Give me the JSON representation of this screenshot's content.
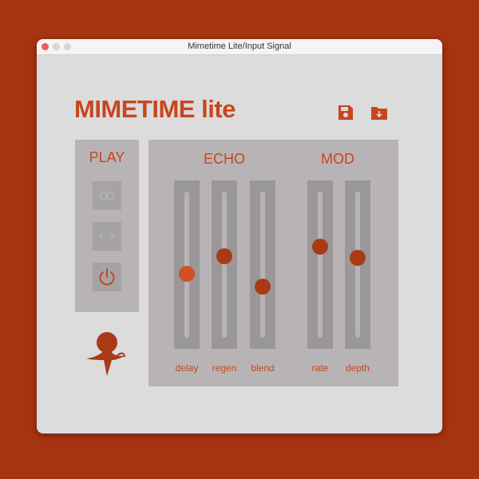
{
  "window": {
    "title": "Mimetime Lite/Input Signal"
  },
  "header": {
    "app_title": "MIMETIME lite",
    "save_icon": "floppy-disk-icon",
    "load_icon": "folder-download-icon"
  },
  "play": {
    "label": "PLAY",
    "buttons": [
      {
        "icon": "loop-infinity-icon"
      },
      {
        "icon": "reverse-arrows-icon"
      },
      {
        "icon": "power-icon",
        "active": true
      }
    ]
  },
  "echo": {
    "label": "ECHO",
    "sliders": [
      {
        "label": "delay",
        "value": 0.43,
        "active": true
      },
      {
        "label": "regen",
        "value": 0.56
      },
      {
        "label": "blend",
        "value": 0.34
      }
    ]
  },
  "mod": {
    "label": "MOD",
    "sliders": [
      {
        "label": "rate",
        "value": 0.63
      },
      {
        "label": "depth",
        "value": 0.55
      }
    ]
  },
  "colors": {
    "accent": "#c7461f",
    "thumb": "#a93a16",
    "thumb_active": "#d05127",
    "panel": "#b8b4b5",
    "background": "#a63312"
  }
}
